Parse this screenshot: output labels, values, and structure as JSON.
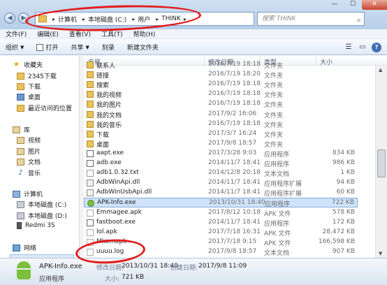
{
  "window": {
    "controls": [
      "—",
      "☐",
      "✕"
    ]
  },
  "address": {
    "crumbs": [
      "计算机",
      "本地磁盘 (C:)",
      "用户",
      "THINK"
    ],
    "search_placeholder": "搜索 THINK"
  },
  "menu": [
    "文件(F)",
    "编辑(E)",
    "查看(V)",
    "工具(T)",
    "帮助(H)"
  ],
  "toolbar": {
    "organize": "组织",
    "open": "打开",
    "share": "共享",
    "burn": "刻录",
    "new_folder": "新建文件夹"
  },
  "nav": {
    "favorites": "收藏夹",
    "fav_items": [
      "2345下载",
      "下载",
      "桌面",
      "最近访问的位置"
    ],
    "libraries": "库",
    "lib_items": [
      "视频",
      "图片",
      "文档",
      "音乐"
    ],
    "computer": "计算机",
    "comp_items": [
      "本地磁盘 (C:)",
      "本地磁盘 (D:)",
      "Redmi 3S"
    ],
    "network": "网络"
  },
  "columns": {
    "name": "名称",
    "date": "修改日期",
    "type": "类型",
    "size": "大小"
  },
  "files": [
    {
      "name": "联系人",
      "date": "2016/7/19 18:18",
      "type": "文件夹",
      "size": "",
      "icon": "folder"
    },
    {
      "name": "链接",
      "date": "2016/7/19 18:20",
      "type": "文件夹",
      "size": "",
      "icon": "folder"
    },
    {
      "name": "搜索",
      "date": "2016/7/19 18:18",
      "type": "文件夹",
      "size": "",
      "icon": "folder"
    },
    {
      "name": "我的视频",
      "date": "2016/7/19 18:18",
      "type": "文件夹",
      "size": "",
      "icon": "folder"
    },
    {
      "name": "我的图片",
      "date": "2016/7/19 18:18",
      "type": "文件夹",
      "size": "",
      "icon": "folder"
    },
    {
      "name": "我的文档",
      "date": "2017/9/2 16:06",
      "type": "文件夹",
      "size": "",
      "icon": "folder"
    },
    {
      "name": "我的音乐",
      "date": "2016/7/19 18:18",
      "type": "文件夹",
      "size": "",
      "icon": "folder"
    },
    {
      "name": "下载",
      "date": "2017/3/7 16:24",
      "type": "文件夹",
      "size": "",
      "icon": "folder"
    },
    {
      "name": "桌面",
      "date": "2017/9/8 18:57",
      "type": "文件夹",
      "size": "",
      "icon": "folder"
    },
    {
      "name": "aapt.exe",
      "date": "2017/3/28 9:03",
      "type": "应用程序",
      "size": "834 KB",
      "icon": "exe"
    },
    {
      "name": "adb.exe",
      "date": "2014/11/7 18:41",
      "type": "应用程序",
      "size": "986 KB",
      "icon": "exe"
    },
    {
      "name": "adb1.0.32.txt",
      "date": "2014/12/8 20:18",
      "type": "文本文档",
      "size": "1 KB",
      "icon": "txt"
    },
    {
      "name": "AdbWinApi.dll",
      "date": "2014/11/7 18:41",
      "type": "应用程序扩展",
      "size": "94 KB",
      "icon": "dll"
    },
    {
      "name": "AdbWinUsbApi.dll",
      "date": "2014/11/7 18:41",
      "type": "应用程序扩展",
      "size": "60 KB",
      "icon": "dll"
    },
    {
      "name": "APK-Info.exe",
      "date": "2013/10/31 18:40",
      "type": "应用程序",
      "size": "722 KB",
      "icon": "apkg"
    },
    {
      "name": "Emmagee.apk",
      "date": "2017/8/12 10:18",
      "type": "APK 文件",
      "size": "578 KB",
      "icon": "apk"
    },
    {
      "name": "fastboot.exe",
      "date": "2014/11/7 18:41",
      "type": "应用程序",
      "size": "172 KB",
      "icon": "exe"
    },
    {
      "name": "lol.apk",
      "date": "2017/7/18 16:31",
      "type": "APK 文件",
      "size": "28,472 KB",
      "icon": "apk"
    },
    {
      "name": "Mkomapk",
      "date": "2017/7/18 9:15",
      "type": "APK 文件",
      "size": "166,598 KB",
      "icon": "apk"
    },
    {
      "name": "uuuu.log",
      "date": "2017/9/8 18:57",
      "type": "文本文档",
      "size": "907 KB",
      "icon": "log"
    }
  ],
  "details": {
    "name": "APK-Info.exe",
    "kind": "应用程序",
    "modified_label": "修改日期:",
    "modified": "2013/10/31 18:40",
    "created_label": "创建日期:",
    "created": "2017/9/8 11:09",
    "size_label": "大小:",
    "size": "721 KB"
  }
}
